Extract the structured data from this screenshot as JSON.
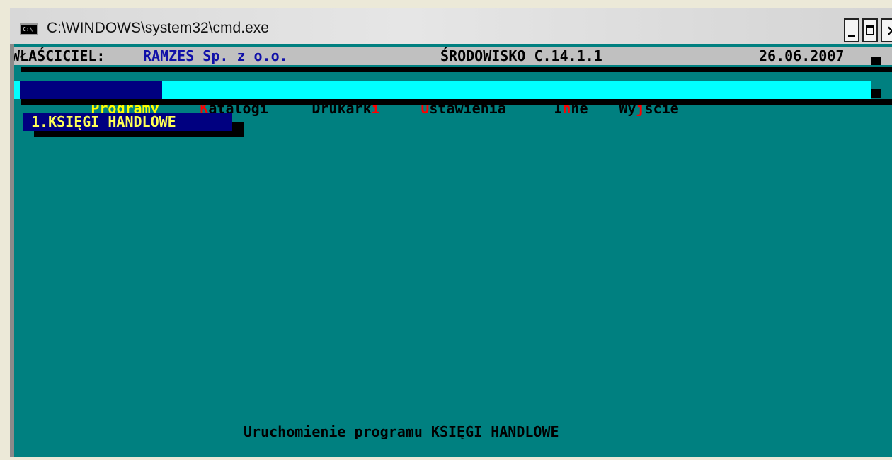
{
  "window": {
    "title": "C:\\WINDOWS\\system32\\cmd.exe",
    "icon_text": "C:\\"
  },
  "header": {
    "owner_label": "WŁAŚCICIEL:",
    "owner_name": "RAMZES Sp. z o.o.",
    "environment": "ŚRODOWISKO C.14.1.1",
    "date": "26.06.2007"
  },
  "menu": {
    "items": [
      {
        "pre": "Programy",
        "hot": "",
        "post": ""
      },
      {
        "pre": "",
        "hot": "K",
        "post": "atalogi"
      },
      {
        "pre": "Drukark",
        "hot": "i",
        "post": ""
      },
      {
        "pre": "",
        "hot": "U",
        "post": "stawienia"
      },
      {
        "pre": "I",
        "hot": "n",
        "post": "ne"
      },
      {
        "pre": "Wy",
        "hot": "j",
        "post": "ście"
      }
    ]
  },
  "programs": {
    "items": [
      "1.KSIĘGI HANDLOWE"
    ]
  },
  "status": {
    "text": "Uruchomienie programu KSIĘGI HANDLOWE"
  },
  "colors": {
    "background": "#008080",
    "menu_bar": "#00ffff",
    "active_bg": "#000080",
    "active_fg": "#ffff00",
    "hotkey": "#ff0000"
  }
}
